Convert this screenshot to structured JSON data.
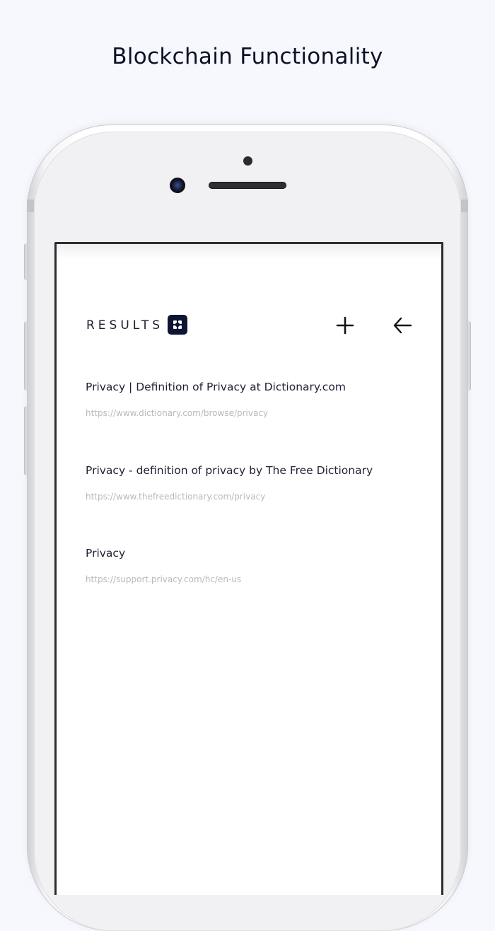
{
  "headline": "Blockchain Functionality",
  "header": {
    "title": "RESULTS",
    "logo_icon": "app-logo-icon",
    "add_icon": "plus-icon",
    "back_icon": "arrow-left-icon"
  },
  "results": [
    {
      "title": "Privacy | Definition of Privacy at Dictionary.com",
      "url": "https://www.dictionary.com/browse/privacy"
    },
    {
      "title": "Privacy - definition of privacy by The Free Dictionary",
      "url": "https://www.thefreedictionary.com/privacy"
    },
    {
      "title": "Privacy",
      "url": "https://support.privacy.com/hc/en-us"
    }
  ],
  "colors": {
    "background": "#f6f8fd",
    "text_primary": "#1e2233",
    "text_url": "#b7b9c0",
    "logo_bg": "#0e1533"
  }
}
